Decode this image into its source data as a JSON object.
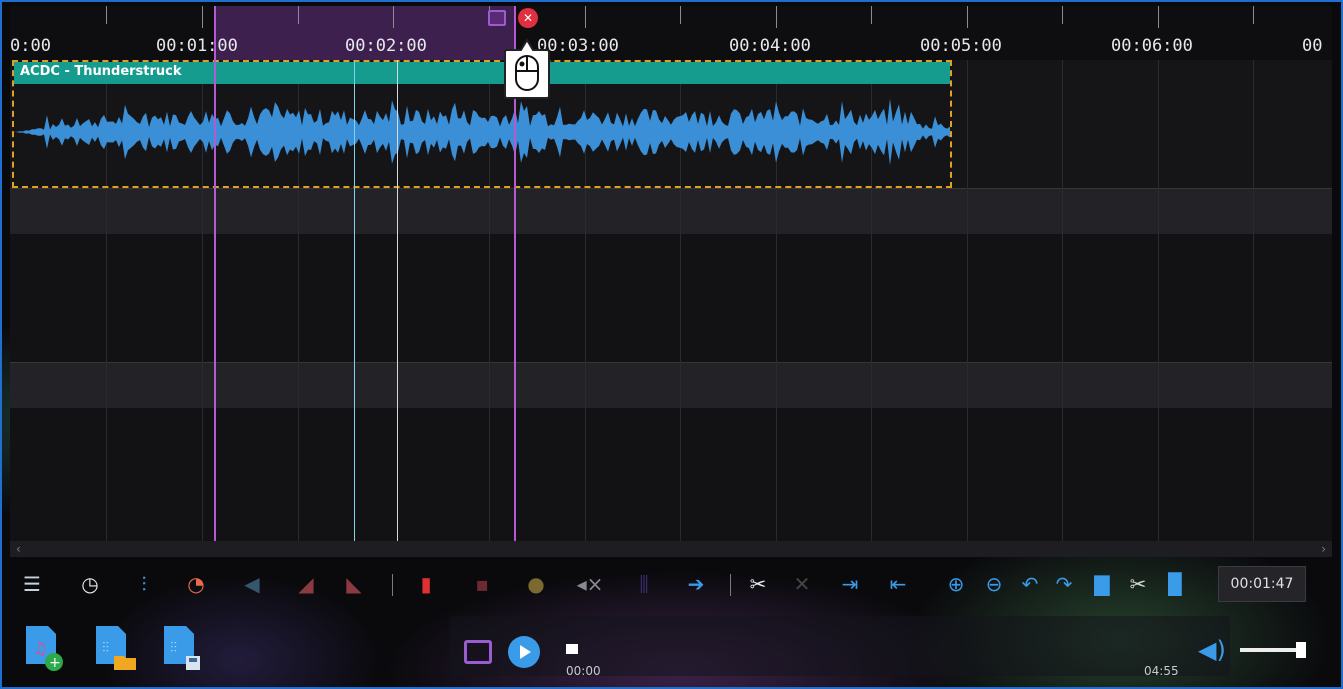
{
  "ruler": {
    "labels": [
      "0:00",
      "00:01:00",
      "00:02:00",
      "00:03:00",
      "00:04:00",
      "00:05:00",
      "00:06:00",
      "00"
    ]
  },
  "clip": {
    "title": "ACDC - Thunderstruck"
  },
  "toolbar": {
    "time_value": "00:01:47",
    "icons": [
      "mixer-icon",
      "clock-icon",
      "waveform-icon",
      "speed-icon",
      "fade-icon",
      "fade-in-icon",
      "fade-out-icon",
      "delete-icon",
      "silence-icon",
      "normalize-icon",
      "mute-icon",
      "split-icon",
      "move-right-icon",
      "cut-icon",
      "trim-icon",
      "snap-end-icon",
      "snap-start-icon",
      "zoom-in-icon",
      "zoom-out-icon",
      "undo-icon",
      "redo-icon",
      "copy-icon",
      "scissors-icon",
      "paste-icon"
    ]
  },
  "player": {
    "current": "00:00",
    "total": "04:55"
  },
  "colors": {
    "accent": "#3a9be8",
    "clip_header": "#169b8f",
    "selection": "#6e328c",
    "waveform": "#3a8fd6",
    "cursor": "#b45ad2"
  }
}
